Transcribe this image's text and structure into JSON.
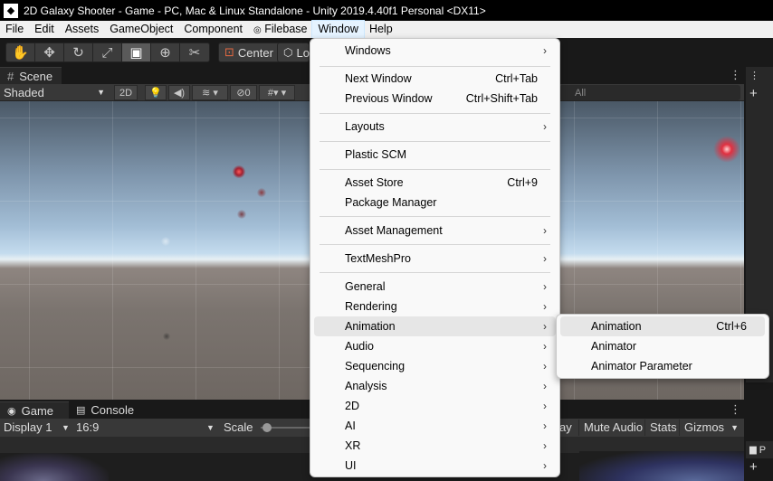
{
  "window": {
    "title": "2D Galaxy Shooter - Game - PC, Mac & Linux Standalone - Unity 2019.4.40f1 Personal <DX11>",
    "app_icon": "unity-icon"
  },
  "menubar": {
    "items": [
      "File",
      "Edit",
      "Assets",
      "GameObject",
      "Component",
      "Filebase",
      "Window",
      "Help"
    ],
    "active": "Window"
  },
  "toolbar": {
    "tools": [
      "hand-tool-icon",
      "move-tool-icon",
      "rotate-tool-icon",
      "scale-tool-icon",
      "rect-tool-icon",
      "transform-tool-icon",
      "custom-tool-icon"
    ],
    "pivot_label": "Center",
    "handle_label": "Lo"
  },
  "scene": {
    "tab_label": "Scene",
    "shading_mode": "Shaded",
    "mode_2d_label": "2D",
    "hidden_count": "0",
    "search_placeholder": "All"
  },
  "game": {
    "tab_label": "Game",
    "console_tab_label": "Console",
    "display": "Display 1",
    "aspect": "16:9",
    "scale_label": "Scale",
    "play_focus_partial": "ay",
    "mute_audio": "Mute Audio",
    "stats": "Stats",
    "gizmos": "Gizmos"
  },
  "right_panel": {
    "top_tab_partial": "",
    "bottom_tab_partial": "P"
  },
  "window_menu": {
    "items": [
      {
        "label": "Windows",
        "shortcut": "",
        "submenu": true
      },
      {
        "label": "Next Window",
        "shortcut": "Ctrl+Tab",
        "submenu": false
      },
      {
        "label": "Previous Window",
        "shortcut": "Ctrl+Shift+Tab",
        "submenu": false
      },
      {
        "label": "Layouts",
        "shortcut": "",
        "submenu": true
      },
      {
        "label": "Plastic SCM",
        "shortcut": "",
        "submenu": false
      },
      {
        "label": "Asset Store",
        "shortcut": "Ctrl+9",
        "submenu": false
      },
      {
        "label": "Package Manager",
        "shortcut": "",
        "submenu": false
      },
      {
        "label": "Asset Management",
        "shortcut": "",
        "submenu": true
      },
      {
        "label": "TextMeshPro",
        "shortcut": "",
        "submenu": true
      },
      {
        "label": "General",
        "shortcut": "",
        "submenu": true
      },
      {
        "label": "Rendering",
        "shortcut": "",
        "submenu": true
      },
      {
        "label": "Animation",
        "shortcut": "",
        "submenu": true
      },
      {
        "label": "Audio",
        "shortcut": "",
        "submenu": true
      },
      {
        "label": "Sequencing",
        "shortcut": "",
        "submenu": true
      },
      {
        "label": "Analysis",
        "shortcut": "",
        "submenu": true
      },
      {
        "label": "2D",
        "shortcut": "",
        "submenu": true
      },
      {
        "label": "AI",
        "shortcut": "",
        "submenu": true
      },
      {
        "label": "XR",
        "shortcut": "",
        "submenu": true
      },
      {
        "label": "UI",
        "shortcut": "",
        "submenu": true
      }
    ],
    "highlighted": "Animation"
  },
  "animation_submenu": {
    "items": [
      {
        "label": "Animation",
        "shortcut": "Ctrl+6"
      },
      {
        "label": "Animator",
        "shortcut": ""
      },
      {
        "label": "Animator Parameter",
        "shortcut": ""
      }
    ]
  },
  "colors": {
    "editor_bg": "#191919",
    "panel_bg": "#383838",
    "menu_bg": "#f9f9f9",
    "menu_highlight": "#e6e6e6",
    "pivot_accent": "#e86a42"
  }
}
